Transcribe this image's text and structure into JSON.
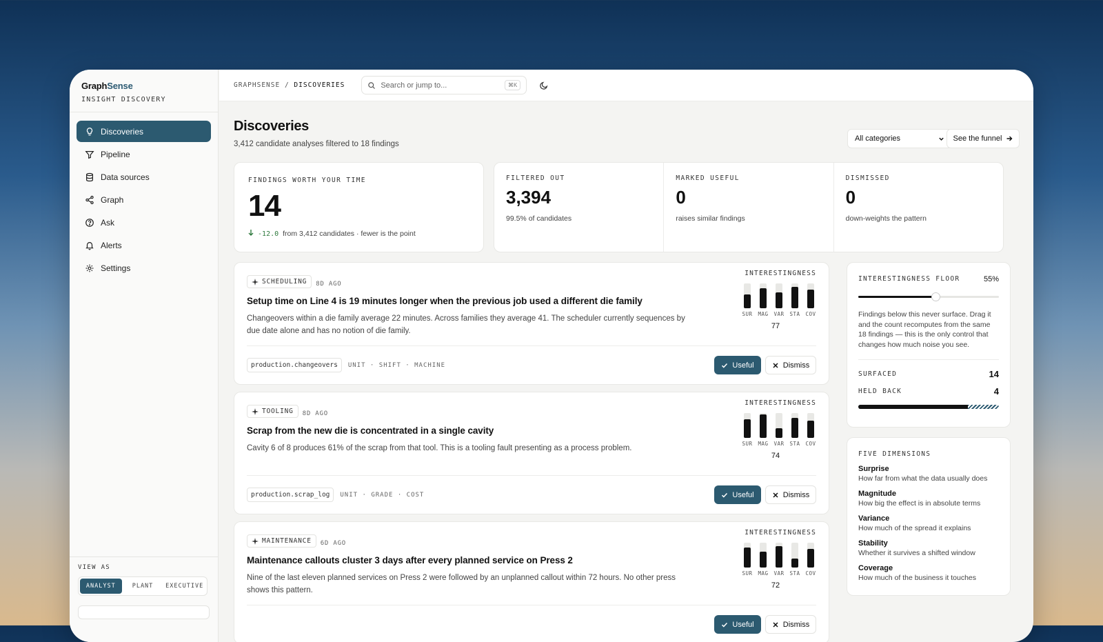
{
  "brand": {
    "name_a": "Graph",
    "name_b": "Sense",
    "subtitle": "INSIGHT DISCOVERY"
  },
  "nav": [
    {
      "label": "Discoveries",
      "icon": "lightbulb-icon",
      "active": true
    },
    {
      "label": "Pipeline",
      "icon": "filter-icon"
    },
    {
      "label": "Data sources",
      "icon": "database-icon"
    },
    {
      "label": "Graph",
      "icon": "share-nodes-icon"
    },
    {
      "label": "Ask",
      "icon": "question-circle-icon"
    },
    {
      "label": "Alerts",
      "icon": "bell-icon"
    },
    {
      "label": "Settings",
      "icon": "gear-icon"
    }
  ],
  "view_as": {
    "label": "VIEW AS",
    "options": [
      "ANALYST",
      "PLANT",
      "EXECUTIVE"
    ],
    "selected": "ANALYST"
  },
  "topbar": {
    "crumb_root": "GRAPHSENSE",
    "crumb_sep": "/",
    "crumb_current": "DISCOVERIES",
    "search_placeholder": "Search or jump to...",
    "search_shortcut": "⌘K"
  },
  "page": {
    "title": "Discoveries",
    "subtitle": "3,412 candidate analyses filtered to 18 findings",
    "category_select": "All categories",
    "funnel_button": "See the funnel"
  },
  "stats": {
    "main": {
      "label": "FINDINGS WORTH YOUR TIME",
      "value": "14",
      "delta": "-12.0",
      "delta_note": "from 3,412 candidates · fewer is the point"
    },
    "cells": [
      {
        "label": "FILTERED OUT",
        "value": "3,394",
        "sub": "99.5% of candidates"
      },
      {
        "label": "MARKED USEFUL",
        "value": "0",
        "sub": "raises similar findings"
      },
      {
        "label": "DISMISSED",
        "value": "0",
        "sub": "down-weights the pattern"
      }
    ]
  },
  "findings": [
    {
      "category": "SCHEDULING",
      "ago": "8D AGO",
      "title": "Setup time on Line 4 is 19 minutes longer when the previous job used a different die family",
      "desc": "Changeovers within a die family average 22 minutes. Across families they average 41. The scheduler currently sequences by due date alone and has no notion of die family.",
      "source": "production.changeovers",
      "dims": "UNIT · SHIFT · MACHINE",
      "score": "77",
      "bars": [
        0.55,
        0.8,
        0.65,
        0.85,
        0.75
      ],
      "useful": "Useful",
      "dismiss": "Dismiss",
      "interest_label": "INTERESTINGNESS"
    },
    {
      "category": "TOOLING",
      "ago": "8D AGO",
      "title": "Scrap from the new die is concentrated in a single cavity",
      "desc": "Cavity 6 of 8 produces 61% of the scrap from that tool. This is a tooling fault presenting as a process problem.",
      "source": "production.scrap_log",
      "dims": "UNIT · GRADE · COST",
      "score": "74",
      "bars": [
        0.75,
        0.95,
        0.4,
        0.8,
        0.7
      ],
      "useful": "Useful",
      "dismiss": "Dismiss",
      "interest_label": "INTERESTINGNESS"
    },
    {
      "category": "MAINTENANCE",
      "ago": "6D AGO",
      "title": "Maintenance callouts cluster 3 days after every planned service on Press 2",
      "desc": "Nine of the last eleven planned services on Press 2 were followed by an unplanned callout within 72 hours. No other press shows this pattern.",
      "source": "",
      "dims": "",
      "score": "72",
      "bars": [
        0.8,
        0.65,
        0.85,
        0.35,
        0.75
      ],
      "useful": "Useful",
      "dismiss": "Dismiss",
      "interest_label": "INTERESTINGNESS"
    }
  ],
  "bar_labels": [
    "SUR",
    "MAG",
    "VAR",
    "STA",
    "COV"
  ],
  "floor": {
    "label": "INTERESTINGNESS FLOOR",
    "value": "55%",
    "fraction": 0.55,
    "text": "Findings below this never surface. Drag it and the count recomputes from the same 18 findings — this is the only control that changes how much noise you see.",
    "surfaced_label": "SURFACED",
    "surfaced": "14",
    "held_label": "HELD BACK",
    "held": "4",
    "surfaced_fraction": 0.78
  },
  "five": {
    "label": "FIVE DIMENSIONS",
    "items": [
      {
        "name": "Surprise",
        "desc": "How far from what the data usually does"
      },
      {
        "name": "Magnitude",
        "desc": "How big the effect is in absolute terms"
      },
      {
        "name": "Variance",
        "desc": "How much of the spread it explains"
      },
      {
        "name": "Stability",
        "desc": "Whether it survives a shifted window"
      },
      {
        "name": "Coverage",
        "desc": "How much of the business it touches"
      }
    ]
  }
}
